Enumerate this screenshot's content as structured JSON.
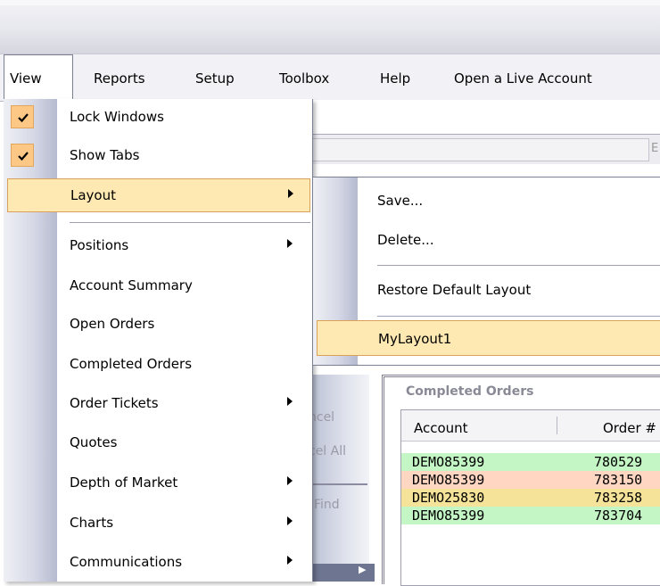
{
  "menubar": {
    "items": [
      "View",
      "Reports",
      "Setup",
      "Toolbox",
      "Help",
      "Open a Live Account"
    ]
  },
  "view_menu": {
    "items": [
      {
        "label": "Lock Windows",
        "checked": true
      },
      {
        "label": "Show Tabs",
        "checked": true
      },
      {
        "label": "Layout",
        "submenu": true,
        "highlighted": true
      },
      {
        "label": "Positions",
        "submenu": true
      },
      {
        "label": "Account Summary"
      },
      {
        "label": "Open Orders"
      },
      {
        "label": "Completed Orders"
      },
      {
        "label": "Order Tickets",
        "submenu": true
      },
      {
        "label": "Quotes"
      },
      {
        "label": "Depth of Market",
        "submenu": true
      },
      {
        "label": "Charts",
        "submenu": true
      },
      {
        "label": "Communications",
        "submenu": true
      }
    ]
  },
  "layout_submenu": {
    "items": [
      {
        "label": "Save..."
      },
      {
        "label": "Delete..."
      },
      {
        "label": "Restore Default Layout"
      },
      {
        "label": "MyLayout1",
        "highlighted": true
      }
    ]
  },
  "background": {
    "toolbar_text": "E",
    "buttons": [
      "ncel",
      "cel All",
      "Find"
    ],
    "completed_orders": {
      "title": "Completed Orders",
      "columns": [
        "Account",
        "Order #"
      ],
      "rows": [
        {
          "account": "DEMO85399",
          "order": "780529",
          "color": "#c4f5c4"
        },
        {
          "account": "DEMO85399",
          "order": "783150",
          "color": "#ffd6c2"
        },
        {
          "account": "DEMO25830",
          "order": "783258",
          "color": "#f5e39a"
        },
        {
          "account": "DEMO85399",
          "order": "783704",
          "color": "#c4f5c4"
        }
      ]
    }
  },
  "colors": {
    "highlight": "#ffe9b3",
    "check_bg": "#fdc886"
  }
}
